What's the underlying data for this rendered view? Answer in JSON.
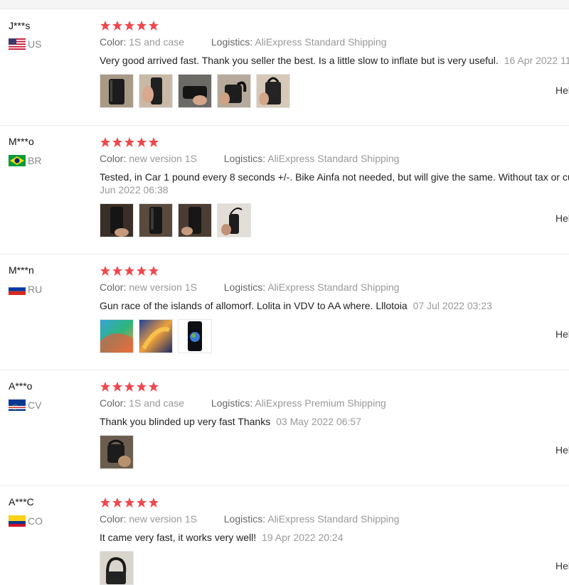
{
  "reviews": [
    {
      "user": "J***s",
      "country": "US",
      "rating": 5,
      "color_label": "Color:",
      "color": "1S and case",
      "logistics_label": "Logistics:",
      "logistics": "AliExpress Standard Shipping",
      "text": "Very good arrived fast. Thank you seller the best. Is a little slow to inflate but is very useful.",
      "date": "16 Apr 2022 11",
      "photos": [
        "photo-1",
        "photo-2",
        "photo-3",
        "photo-4",
        "photo-5"
      ],
      "helpful": "Hel"
    },
    {
      "user": "M***o",
      "country": "BR",
      "rating": 5,
      "color_label": "Color:",
      "color": "new version 1S",
      "logistics_label": "Logistics:",
      "logistics": "AliExpress Standard Shipping",
      "text": "Tested, in Car 1 pound every 8 seconds +/-. Bike Ainfa not needed, but will give the same. Without tax or cu",
      "date": "Jun 2022 06:38",
      "photos": [
        "photo-1",
        "photo-2",
        "photo-3",
        "photo-4"
      ],
      "helpful": "Hel"
    },
    {
      "user": "M***n",
      "country": "RU",
      "rating": 5,
      "color_label": "Color:",
      "color": "new version 1S",
      "logistics_label": "Logistics:",
      "logistics": "AliExpress Standard Shipping",
      "text": "Gun race of the islands of allomorf. Lolita in VDV to AA where. Lllotoia",
      "date": "07 Jul 2022 03:23",
      "photos": [
        "photo-1",
        "photo-2",
        "photo-3"
      ],
      "helpful": "Hel"
    },
    {
      "user": "A***o",
      "country": "CV",
      "rating": 5,
      "color_label": "Color:",
      "color": "1S and case",
      "logistics_label": "Logistics:",
      "logistics": "AliExpress Premium Shipping",
      "text": "Thank you blinded up very fast Thanks",
      "date": "03 May 2022 06:57",
      "photos": [
        "photo-1"
      ],
      "helpful": "Hel"
    },
    {
      "user": "A***C",
      "country": "CO",
      "rating": 5,
      "color_label": "Color:",
      "color": "new version 1S",
      "logistics_label": "Logistics:",
      "logistics": "AliExpress Standard Shipping",
      "text": "It came very fast, it works very well!",
      "date": "19 Apr 2022 20:24",
      "photos": [
        "photo-1"
      ],
      "helpful": "Hel"
    }
  ],
  "colors": {
    "star": "#f0474d",
    "muted": "#999999",
    "text": "#222222"
  }
}
